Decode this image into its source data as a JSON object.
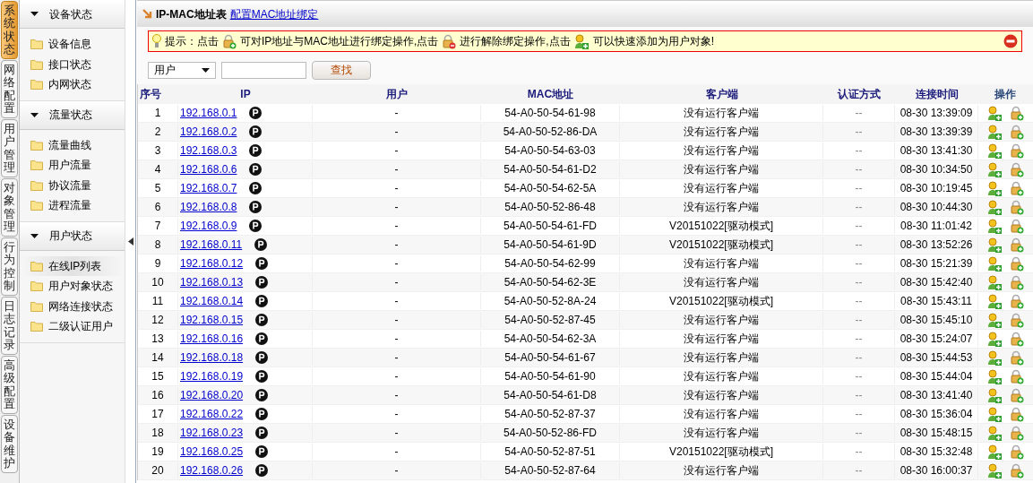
{
  "nav_tabs": [
    {
      "label": "系统状态",
      "selected": true
    },
    {
      "label": "网络配置",
      "selected": false
    },
    {
      "label": "用户管理",
      "selected": false
    },
    {
      "label": "对象管理",
      "selected": false
    },
    {
      "label": "行为控制",
      "selected": false
    },
    {
      "label": "日志记录",
      "selected": false
    },
    {
      "label": "高级配置",
      "selected": false
    },
    {
      "label": "设备维护",
      "selected": false
    }
  ],
  "sidebar": [
    {
      "title": "设备状态",
      "expanded": true,
      "items": [
        {
          "label": "设备信息",
          "selected": false
        },
        {
          "label": "接口状态",
          "selected": false
        },
        {
          "label": "内网状态",
          "selected": false
        }
      ]
    },
    {
      "title": "流量状态",
      "expanded": true,
      "items": [
        {
          "label": "流量曲线",
          "selected": false
        },
        {
          "label": "用户流量",
          "selected": false
        },
        {
          "label": "协议流量",
          "selected": false
        },
        {
          "label": "进程流量",
          "selected": false
        }
      ]
    },
    {
      "title": "用户状态",
      "expanded": true,
      "items": [
        {
          "label": "在线IP列表",
          "selected": true
        },
        {
          "label": "用户对象状态",
          "selected": false
        },
        {
          "label": "网络连接状态",
          "selected": false
        },
        {
          "label": "二级认证用户",
          "selected": false
        }
      ]
    }
  ],
  "page": {
    "title": "IP-MAC地址表",
    "link": "配置MAC地址绑定"
  },
  "notice": {
    "parts": [
      "提示：点击",
      "可对IP地址与MAC地址进行绑定操作,点击",
      "进行解除绑定操作,点击",
      "可以快速添加为用户对象!"
    ]
  },
  "search": {
    "field": "用户",
    "button": "查找"
  },
  "table": {
    "columns": [
      "序号",
      "IP",
      "用户",
      "MAC地址",
      "客户端",
      "认证方式",
      "连接时间",
      "操作"
    ],
    "rows": [
      [
        "1",
        "192.168.0.1",
        "-",
        "54-A0-50-54-61-98",
        "没有运行客户端",
        "--",
        "08-30 13:39:09"
      ],
      [
        "2",
        "192.168.0.2",
        "-",
        "54-A0-50-52-86-DA",
        "没有运行客户端",
        "--",
        "08-30 13:39:39"
      ],
      [
        "3",
        "192.168.0.3",
        "-",
        "54-A0-50-54-63-03",
        "没有运行客户端",
        "--",
        "08-30 13:41:30"
      ],
      [
        "4",
        "192.168.0.6",
        "-",
        "54-A0-50-54-61-D2",
        "没有运行客户端",
        "--",
        "08-30 10:34:50"
      ],
      [
        "5",
        "192.168.0.7",
        "-",
        "54-A0-50-54-62-5A",
        "没有运行客户端",
        "--",
        "08-30 10:19:45"
      ],
      [
        "6",
        "192.168.0.8",
        "-",
        "54-A0-50-52-86-48",
        "没有运行客户端",
        "--",
        "08-30 10:44:30"
      ],
      [
        "7",
        "192.168.0.9",
        "-",
        "54-A0-50-54-61-FD",
        "V20151022[驱动模式]",
        "--",
        "08-30 11:01:42"
      ],
      [
        "8",
        "192.168.0.11",
        "-",
        "54-A0-50-54-61-9D",
        "V20151022[驱动模式]",
        "--",
        "08-30 13:52:26"
      ],
      [
        "9",
        "192.168.0.12",
        "-",
        "54-A0-50-54-62-99",
        "没有运行客户端",
        "--",
        "08-30 15:21:39"
      ],
      [
        "10",
        "192.168.0.13",
        "-",
        "54-A0-50-54-62-3E",
        "没有运行客户端",
        "--",
        "08-30 15:42:40"
      ],
      [
        "11",
        "192.168.0.14",
        "-",
        "54-A0-50-52-8A-24",
        "V20151022[驱动模式]",
        "--",
        "08-30 15:43:11"
      ],
      [
        "12",
        "192.168.0.15",
        "-",
        "54-A0-50-52-87-45",
        "没有运行客户端",
        "--",
        "08-30 15:45:10"
      ],
      [
        "13",
        "192.168.0.16",
        "-",
        "54-A0-50-54-62-3A",
        "没有运行客户端",
        "--",
        "08-30 15:24:07"
      ],
      [
        "14",
        "192.168.0.18",
        "-",
        "54-A0-50-54-61-67",
        "没有运行客户端",
        "--",
        "08-30 15:44:53"
      ],
      [
        "15",
        "192.168.0.19",
        "-",
        "54-A0-50-54-61-90",
        "没有运行客户端",
        "--",
        "08-30 15:44:04"
      ],
      [
        "16",
        "192.168.0.20",
        "-",
        "54-A0-50-54-61-D8",
        "没有运行客户端",
        "--",
        "08-30 13:41:40"
      ],
      [
        "17",
        "192.168.0.22",
        "-",
        "54-A0-50-52-87-37",
        "没有运行客户端",
        "--",
        "08-30 15:36:04"
      ],
      [
        "18",
        "192.168.0.23",
        "-",
        "54-A0-50-52-86-FD",
        "没有运行客户端",
        "--",
        "08-30 15:48:15"
      ],
      [
        "19",
        "192.168.0.25",
        "-",
        "54-A0-50-52-87-51",
        "V20151022[驱动模式]",
        "--",
        "08-30 15:32:48"
      ],
      [
        "20",
        "192.168.0.26",
        "-",
        "54-A0-50-52-87-64",
        "没有运行客户端",
        "--",
        "08-30 16:00:37"
      ]
    ]
  }
}
